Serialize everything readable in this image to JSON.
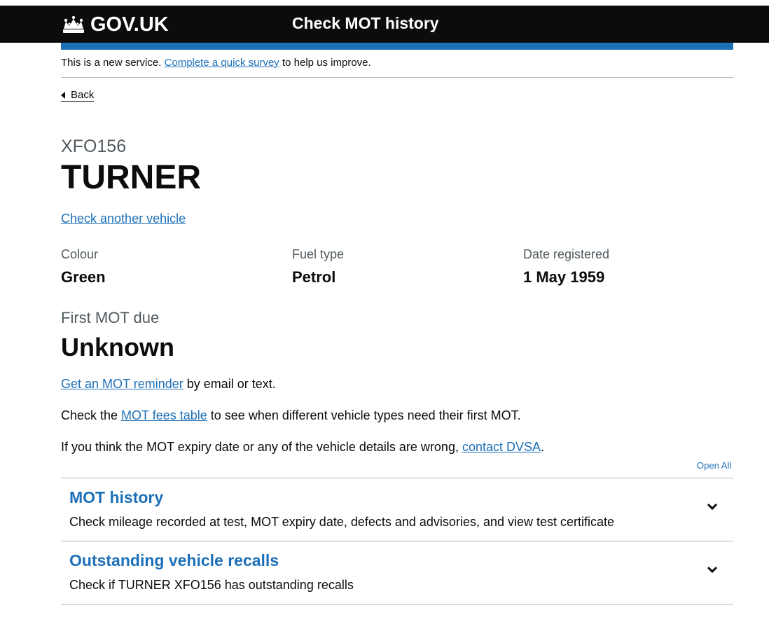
{
  "header": {
    "logo_text": "GOV.UK",
    "service_name": "Check MOT history"
  },
  "beta_banner": {
    "prefix": "This is a new service. ",
    "link": "Complete a quick survey",
    "suffix": " to help us improve."
  },
  "back_link": "Back",
  "vehicle": {
    "registration": "XFO156",
    "make": "TURNER",
    "check_another": "Check another vehicle",
    "details": [
      {
        "label": "Colour",
        "value": "Green"
      },
      {
        "label": "Fuel type",
        "value": "Petrol"
      },
      {
        "label": "Date registered",
        "value": "1 May 1959"
      }
    ],
    "first_mot_label": "First MOT due",
    "first_mot_value": "Unknown"
  },
  "paragraphs": {
    "reminder_link": "Get an MOT reminder",
    "reminder_suffix": " by email or text.",
    "fees_prefix": "Check the ",
    "fees_link": "MOT fees table",
    "fees_suffix": " to see when different vehicle types need their first MOT.",
    "wrong_prefix": "If you think the MOT expiry date or any of the vehicle details are wrong, ",
    "wrong_link": "contact DVSA",
    "wrong_suffix": "."
  },
  "accordion": {
    "open_all": "Open All",
    "sections": [
      {
        "title": "MOT history",
        "summary": "Check mileage recorded at test, MOT expiry date, defects and advisories, and view test certificate"
      },
      {
        "title": "Outstanding vehicle recalls",
        "summary": "Check if TURNER XFO156 has outstanding recalls"
      }
    ]
  },
  "colors": {
    "header_bg": "#0b0c0c",
    "brand_blue": "#1d70b8",
    "link": "#1d70b8",
    "secondary_text": "#505a5f"
  },
  "icons": [
    "crown-icon",
    "back-arrow-icon",
    "chevron-down-icon"
  ]
}
